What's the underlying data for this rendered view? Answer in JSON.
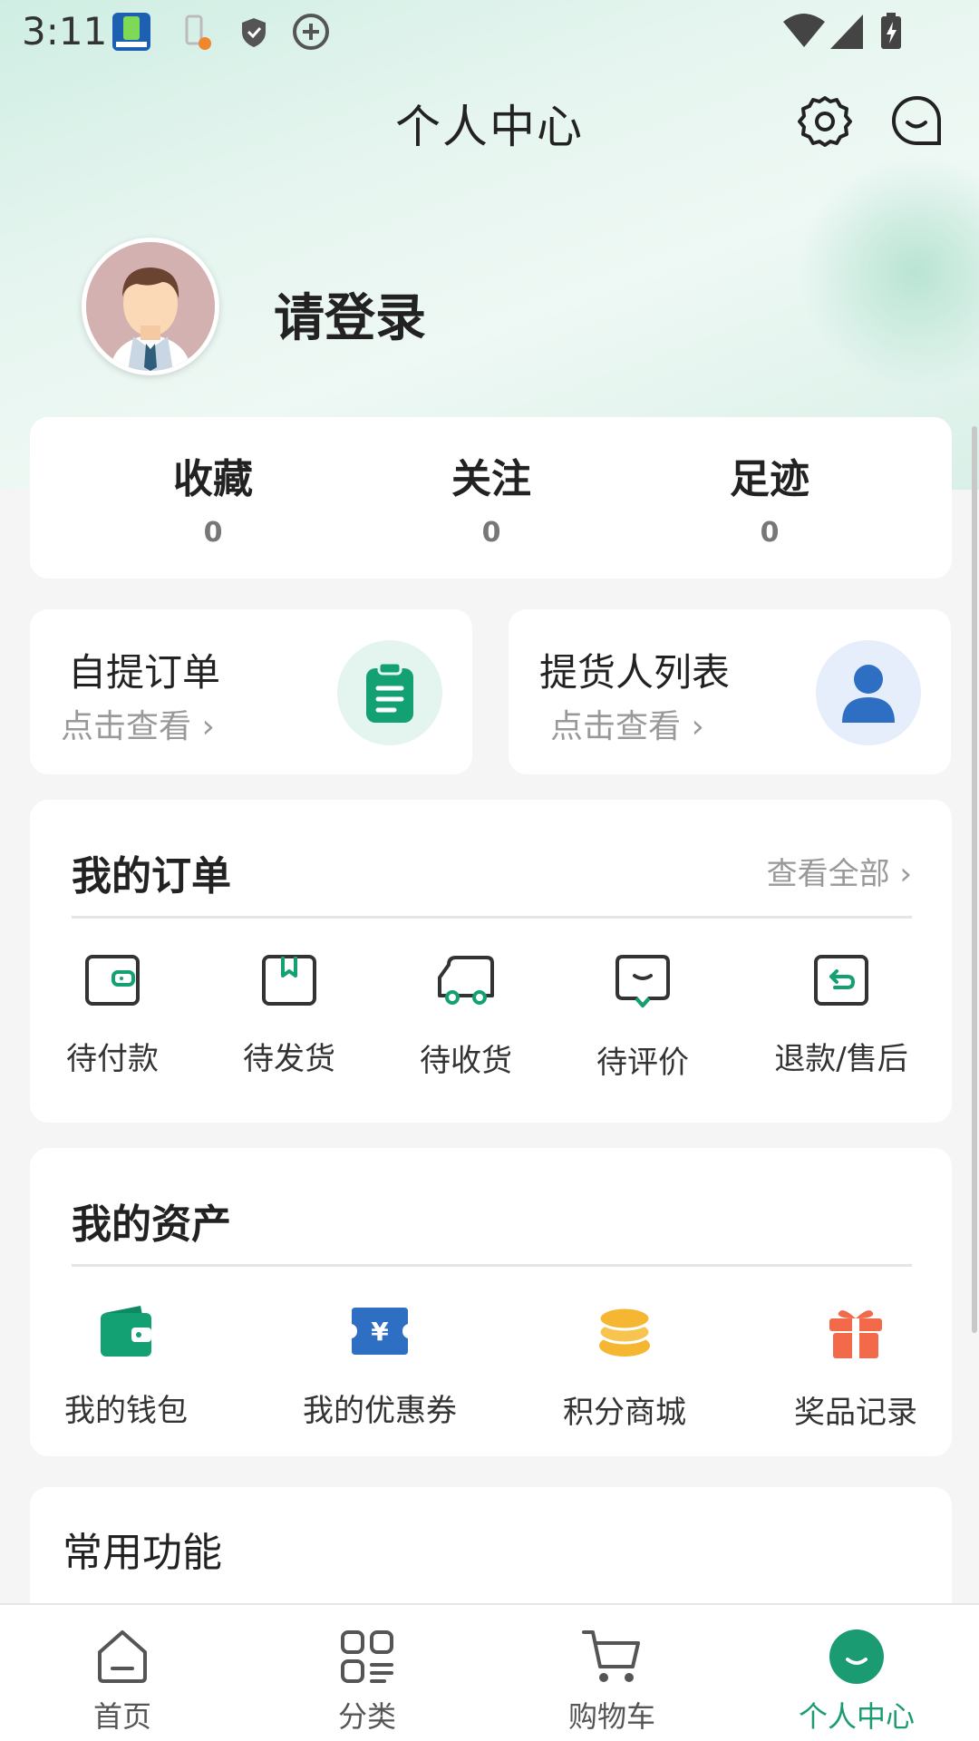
{
  "status_bar": {
    "time": "3:11"
  },
  "header": {
    "title": "个人中心"
  },
  "profile": {
    "login_prompt": "请登录"
  },
  "stats": [
    {
      "label": "收藏",
      "value": "0"
    },
    {
      "label": "关注",
      "value": "0"
    },
    {
      "label": "足迹",
      "value": "0"
    }
  ],
  "shortcuts": [
    {
      "title": "自提订单",
      "subtitle": "点击查看"
    },
    {
      "title": "提货人列表",
      "subtitle": "点击查看"
    }
  ],
  "orders": {
    "title": "我的订单",
    "view_all": "查看全部",
    "items": [
      {
        "label": "待付款",
        "icon": "wallet-outline-icon"
      },
      {
        "label": "待发货",
        "icon": "box-outline-icon"
      },
      {
        "label": "待收货",
        "icon": "truck-outline-icon"
      },
      {
        "label": "待评价",
        "icon": "comment-outline-icon"
      },
      {
        "label": "退款/售后",
        "icon": "return-outline-icon"
      }
    ]
  },
  "assets": {
    "title": "我的资产",
    "items": [
      {
        "label": "我的钱包",
        "icon": "wallet-icon",
        "color": "#13a174"
      },
      {
        "label": "我的优惠券",
        "icon": "coupon-icon",
        "color": "#2e6fc4"
      },
      {
        "label": "积分商城",
        "icon": "coins-icon",
        "color": "#f5b731"
      },
      {
        "label": "奖品记录",
        "icon": "gift-icon",
        "color": "#f26a4a"
      }
    ]
  },
  "common": {
    "title": "常用功能"
  },
  "bottom_nav": [
    {
      "label": "首页"
    },
    {
      "label": "分类"
    },
    {
      "label": "购物车"
    },
    {
      "label": "个人中心"
    }
  ],
  "colors": {
    "accent": "#1a9b72",
    "background": "#f5f5f5"
  }
}
